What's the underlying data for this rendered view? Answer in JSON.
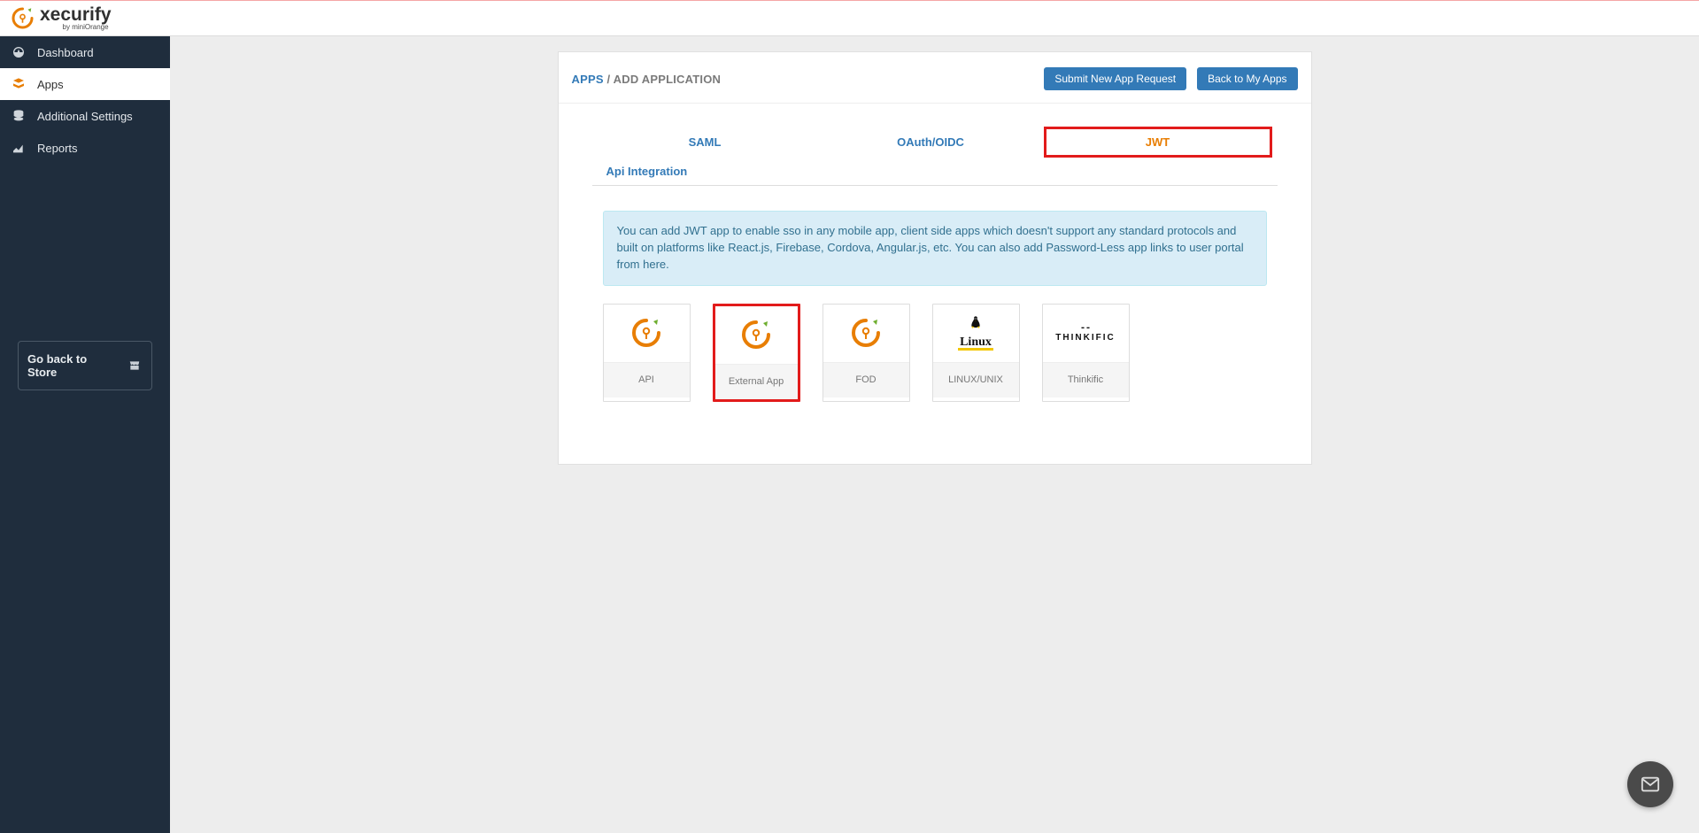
{
  "brand": {
    "name": "xecurify",
    "sub": "by miniOrange"
  },
  "sidebar": {
    "items": [
      {
        "label": "Dashboard"
      },
      {
        "label": "Apps"
      },
      {
        "label": "Additional Settings"
      },
      {
        "label": "Reports"
      }
    ],
    "back_store": "Go back to Store"
  },
  "crumbs": {
    "root": "APPS",
    "sep": "/",
    "page": "ADD APPLICATION"
  },
  "head_buttons": {
    "submit": "Submit New App Request",
    "back": "Back to My Apps"
  },
  "tabs": {
    "saml": "SAML",
    "oauth": "OAuth/OIDC",
    "jwt": "JWT",
    "api": "Api Integration"
  },
  "info_text": "You can add JWT app to enable sso in any mobile app, client side apps which doesn't support any standard protocols and built on platforms like React.js, Firebase, Cordova, Angular.js, etc. You can also add Password-Less app links to user portal from here.",
  "cards": {
    "api": "API",
    "external": "External App",
    "fod": "FOD",
    "linux": "LINUX/UNIX",
    "thinkific": "Thinkific"
  }
}
